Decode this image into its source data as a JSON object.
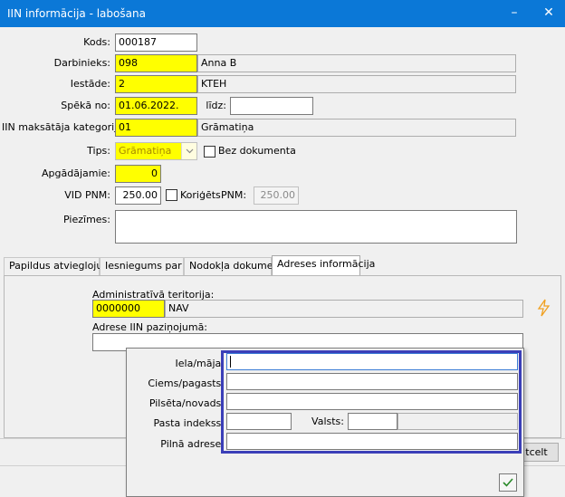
{
  "window": {
    "title": "IIN informācija - labošana",
    "minimize": "–",
    "close": "✕"
  },
  "form": {
    "kods": {
      "label": "Kods:",
      "value": "000187"
    },
    "darbinieks": {
      "label": "Darbinieks:",
      "code": "098",
      "name": "Anna B"
    },
    "iestade": {
      "label": "Iestāde:",
      "code": "2",
      "name": "KTEH"
    },
    "speka": {
      "label": "Spēkā no:",
      "value": "01.06.2022.",
      "lidz_label": "līdz:",
      "lidz_value": ""
    },
    "kategorija": {
      "label": "IIN maksātāja kategorija:",
      "code": "01",
      "name": "Grāmatiņa"
    },
    "tips": {
      "label": "Tips:",
      "value": "Grāmatiņa",
      "bez_dokumenta": "Bez dokumenta"
    },
    "apgadajamie": {
      "label": "Apgādājamie:",
      "value": "0"
    },
    "vid_pnm": {
      "label": "VID PNM:",
      "value": "250.00",
      "koriģets": "Koriģēts",
      "pnm_label": "PNM:",
      "pnm_value": "250.00"
    },
    "piezimes": {
      "label": "Piezīmes:",
      "value": ""
    }
  },
  "tabs": [
    {
      "label": "Papildus atvieglojumi"
    },
    {
      "label": "Iesniegums par %"
    },
    {
      "label": "Nodokļa dokuments"
    },
    {
      "label": "Adreses informācija"
    }
  ],
  "tab_content": {
    "territory_label": "Administratīvā teritorija:",
    "territory_code": "0000000",
    "territory_name": "NAV",
    "address_label": "Adrese IIN paziņojumā:",
    "address_value": ""
  },
  "popup": {
    "iela_label": "Iela/māja:",
    "ciems_label": "Ciems/pagasts:",
    "pilseta_label": "Pilsēta/novads:",
    "pasta_label": "Pasta indekss:",
    "valsts_label": "Valsts:",
    "pilna_label": "Pilnā adrese:"
  },
  "footer": {
    "cancel_partial": "tcelt"
  },
  "colors": {
    "titlebar": "#0b78d7",
    "highlight": "#ffff00",
    "popup_frame": "#3b3fb8",
    "lightning": "#f0a020"
  }
}
